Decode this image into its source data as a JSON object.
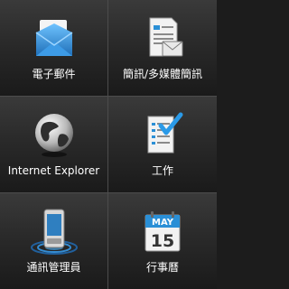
{
  "tiles": [
    {
      "label": "電子郵件",
      "icon": "email-envelope-icon"
    },
    {
      "label": "簡訊/多媒體簡訊",
      "icon": "sms-mms-document-icon"
    },
    {
      "label": "Internet Explorer",
      "icon": "globe-icon"
    },
    {
      "label": "工作",
      "icon": "tasks-checklist-icon"
    },
    {
      "label": "通訊管理員",
      "icon": "comm-manager-device-icon"
    },
    {
      "label": "行事曆",
      "icon": "calendar-icon"
    }
  ],
  "calendar_icon": {
    "month": "MAY",
    "day": "15"
  },
  "colors": {
    "background": "#1c1c1c",
    "divider": "#4c4c4c",
    "label": "#ffffff",
    "accent_blue": "#2a8fd6"
  }
}
